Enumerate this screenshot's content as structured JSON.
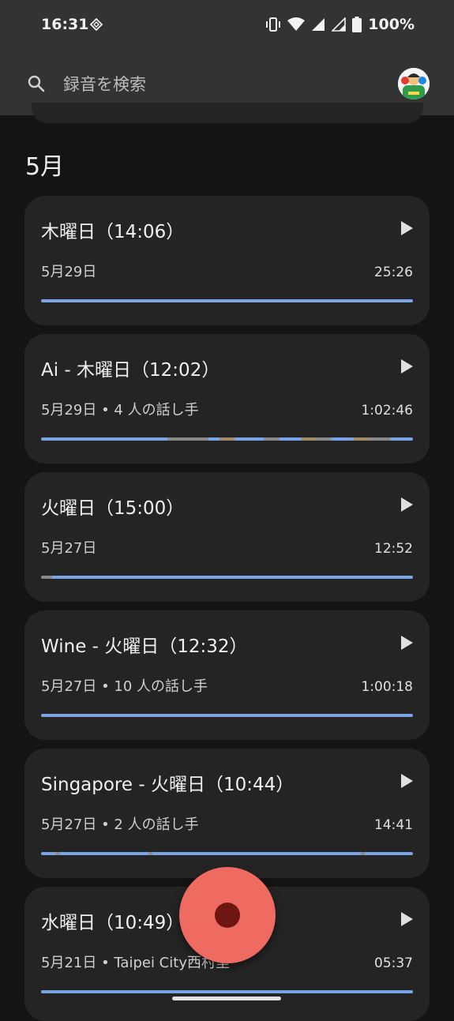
{
  "status_bar": {
    "time": "16:31",
    "battery": "100%",
    "icons": [
      "diamond-icon",
      "vibrate-icon",
      "wifi-icon",
      "signal-icon",
      "signal-icon",
      "battery-icon"
    ]
  },
  "search": {
    "placeholder": "録音を検索",
    "icon": "search-icon"
  },
  "month_header": "5月",
  "recordings": [
    {
      "title": "木曜日（14:06）",
      "subtitle": "5月29日",
      "duration": "25:26"
    },
    {
      "title": "Ai - 木曜日（12:02）",
      "subtitle": "5月29日 • 4 人の話し手",
      "duration": "1:02:46"
    },
    {
      "title": "火曜日（15:00）",
      "subtitle": "5月27日",
      "duration": "12:52"
    },
    {
      "title": "Wine - 火曜日（12:32）",
      "subtitle": "5月27日 • 10 人の話し手",
      "duration": "1:00:18"
    },
    {
      "title": "Singapore - 火曜日（10:44）",
      "subtitle": "5月27日 • 2 人の話し手",
      "duration": "14:41"
    },
    {
      "title": "水曜日（10:49）",
      "subtitle": "5月21日 • Taipei City西村里",
      "duration": "05:37"
    }
  ],
  "colors": {
    "progress": "#7aa3e5",
    "fab": "#ef6a60",
    "fab_dot": "#6e1712",
    "card": "#242424"
  }
}
